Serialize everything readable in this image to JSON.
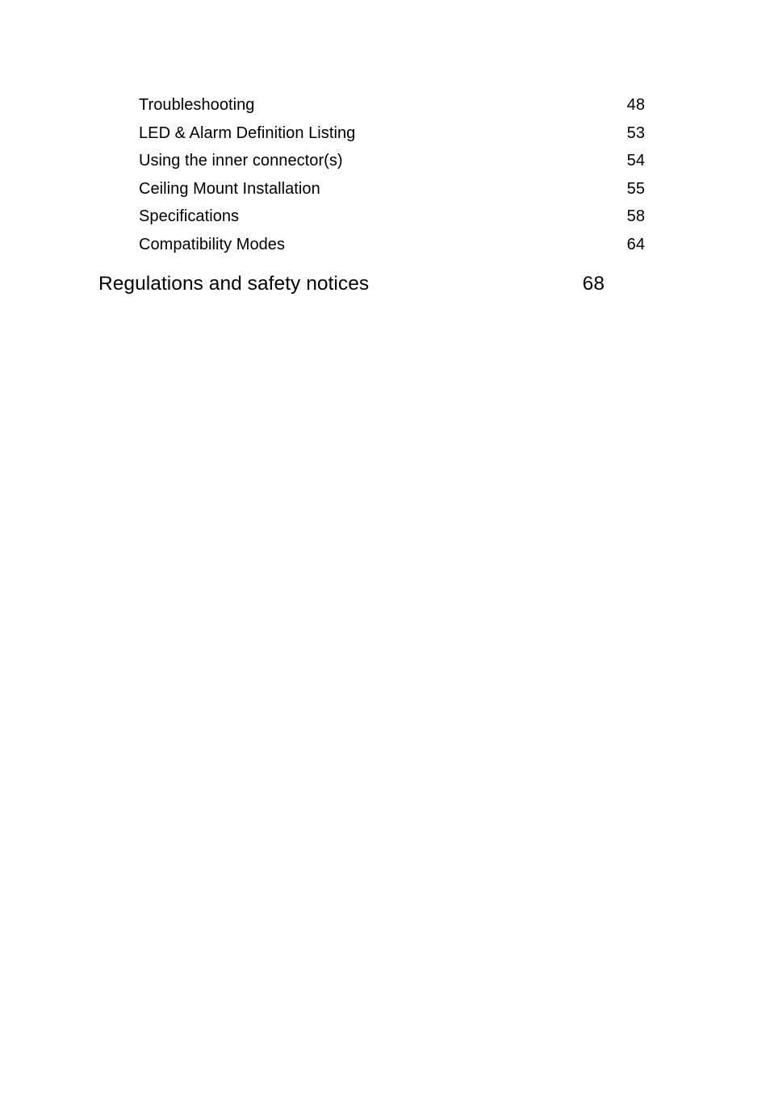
{
  "document": {
    "type": "table-of-contents",
    "page_background": "#ffffff",
    "text_color": "#000000"
  },
  "toc": {
    "entries": [
      {
        "label": "Troubleshooting",
        "page": "48",
        "level": 2
      },
      {
        "label": "LED & Alarm Definition Listing",
        "page": "53",
        "level": 2
      },
      {
        "label": "Using the inner connector(s)",
        "page": "54",
        "level": 2
      },
      {
        "label": "Ceiling Mount Installation",
        "page": "55",
        "level": 2
      },
      {
        "label": "Specifications",
        "page": "58",
        "level": 2
      },
      {
        "label": "Compatibility Modes",
        "page": "64",
        "level": 2
      },
      {
        "label": "Regulations and safety notices",
        "page": "68",
        "level": 1
      }
    ]
  }
}
